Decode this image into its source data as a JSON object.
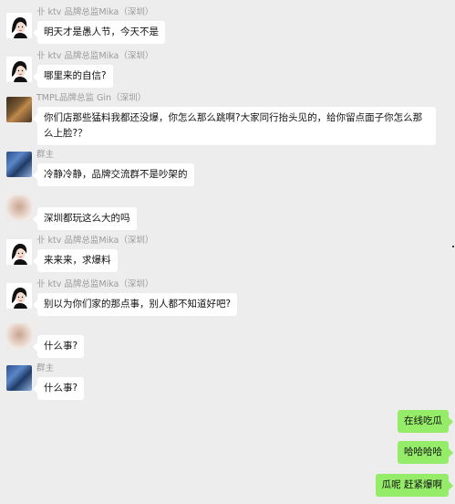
{
  "messages": [
    {
      "sender": "卝 ktv 品牌总监Mika（深圳）",
      "text": "明天才是愚人节，今天不是"
    },
    {
      "sender": "卝 ktv 品牌总监Mika（深圳）",
      "text": "哪里来的自信?"
    },
    {
      "sender": "TMPL品牌总监 Gin（深圳）",
      "text": "你们店那些猛料我都还没爆，你怎么那么跳啊?大家同行抬头见的，给你留点面子你怎么那么上脸?？"
    },
    {
      "sender": "群主",
      "text": "冷静冷静，品牌交流群不是吵架的"
    },
    {
      "sender": "",
      "text": "深圳都玩这么大的吗"
    },
    {
      "sender": "卝 ktv 品牌总监Mika（深圳）",
      "text": "来来来，求爆料"
    },
    {
      "sender": "卝 ktv 品牌总监Mika（深圳）",
      "text": "别以为你们家的那点事，别人都不知道好吧?"
    },
    {
      "sender": "",
      "text": "什么事?"
    },
    {
      "sender": "群主",
      "text": "什么事?"
    },
    {
      "sender": "",
      "text": "在线吃瓜",
      "mine": true
    },
    {
      "sender": "",
      "text": "哈哈哈哈",
      "mine": true
    },
    {
      "sender": "",
      "text": "瓜呢  赶紧爆啊",
      "mine": true
    }
  ],
  "colors": {
    "background": "#ededed",
    "incoming_bubble": "#ffffff",
    "outgoing_bubble": "#95ec69",
    "sender_name": "#9a9a9a"
  }
}
